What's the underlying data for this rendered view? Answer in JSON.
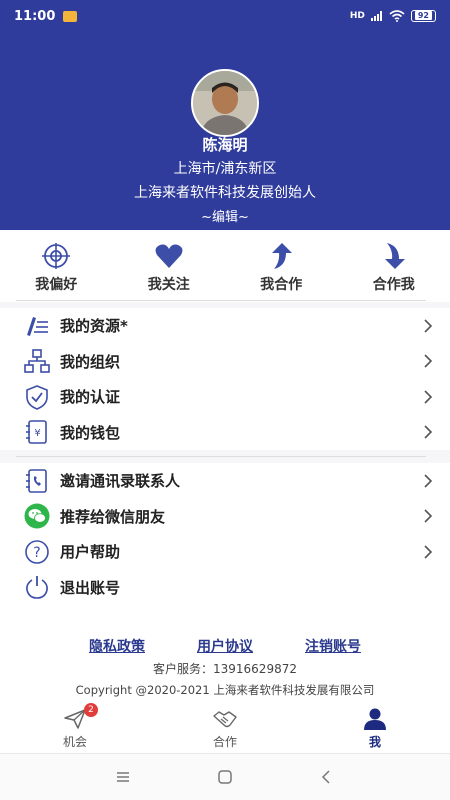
{
  "status": {
    "time": "11:00",
    "signal_text": "HD",
    "battery": "92"
  },
  "profile": {
    "name": "陈海明",
    "location": "上海市/浦东新区",
    "title": "上海来者软件科技发展创始人",
    "edit_label": "~编辑~"
  },
  "quick_actions": [
    {
      "label": "我偏好",
      "icon": "target-icon"
    },
    {
      "label": "我关注",
      "icon": "heart-icon"
    },
    {
      "label": "我合作",
      "icon": "arrow-up-icon"
    },
    {
      "label": "合作我",
      "icon": "arrow-down-icon"
    }
  ],
  "menu_group1": [
    {
      "label": "我的资源*",
      "icon": "resource-icon"
    },
    {
      "label": "我的组织",
      "icon": "organization-icon"
    },
    {
      "label": "我的认证",
      "icon": "shield-check-icon"
    },
    {
      "label": "我的钱包",
      "icon": "wallet-icon"
    }
  ],
  "menu_group2": [
    {
      "label": "邀请通讯录联系人",
      "icon": "contacts-phone-icon"
    },
    {
      "label": "推荐给微信朋友",
      "icon": "wechat-icon"
    },
    {
      "label": "用户帮助",
      "icon": "help-icon"
    },
    {
      "label": "退出账号",
      "icon": "power-icon"
    }
  ],
  "footer": {
    "links": [
      "隐私政策",
      "用户协议",
      "注销账号"
    ],
    "service": "客户服务：13916629872",
    "copyright": "Copyright @2020-2021 上海来者软件科技发展有限公司"
  },
  "tabbar": {
    "tabs": [
      {
        "label": "机会",
        "icon": "send-icon"
      },
      {
        "label": "合作",
        "icon": "handshake-icon"
      },
      {
        "label": "我",
        "icon": "person-icon"
      }
    ],
    "badge": "2",
    "active_index": 2
  },
  "colors": {
    "header_bg": "#2f3c9c",
    "icon_blue": "#3d4ea8",
    "badge_red": "#e23c3c"
  }
}
